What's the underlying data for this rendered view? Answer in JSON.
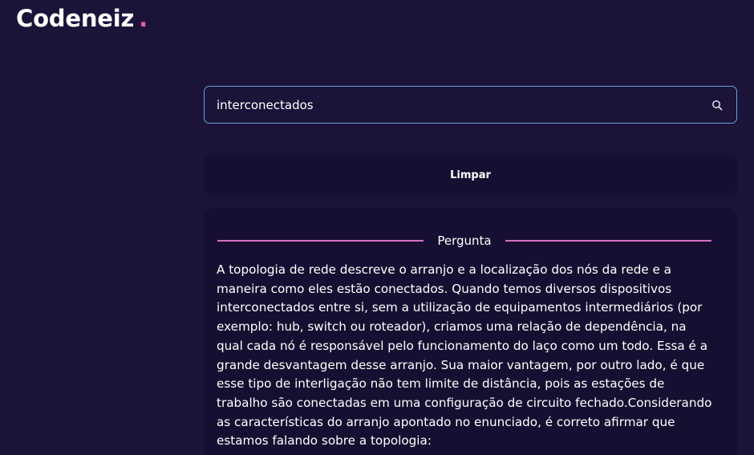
{
  "brand": {
    "name": "Codeneiz",
    "dot": "."
  },
  "search": {
    "value": "interconectados",
    "placeholder": "",
    "icon": "search-icon"
  },
  "actions": {
    "clear_label": "Limpar"
  },
  "question": {
    "section_title": "Pergunta",
    "text": "A topologia de rede descreve o arranjo e a localização dos nós da rede e a maneira como eles estão conectados. Quando temos diversos dispositivos interconectados entre si, sem a utilização de equipamentos intermediários (por exemplo: hub, switch ou roteador), criamos uma relação de dependência, na qual cada nó é responsável pelo funcionamento do laço como um todo. Essa é a grande desvantagem desse arranjo. Sua maior vantagem, por outro lado, é que esse tipo de interligação não tem limite de distância, pois as estações de trabalho são conectadas em uma configuração de circuito fechado.Considerando as características do arranjo apontado no enunciado, é correto afirmar que estamos falando sobre a topologia:"
  },
  "colors": {
    "background": "#1c1339",
    "panel": "#170f31",
    "accent_pink": "#e75fb8",
    "input_border": "#5fa5d8"
  }
}
